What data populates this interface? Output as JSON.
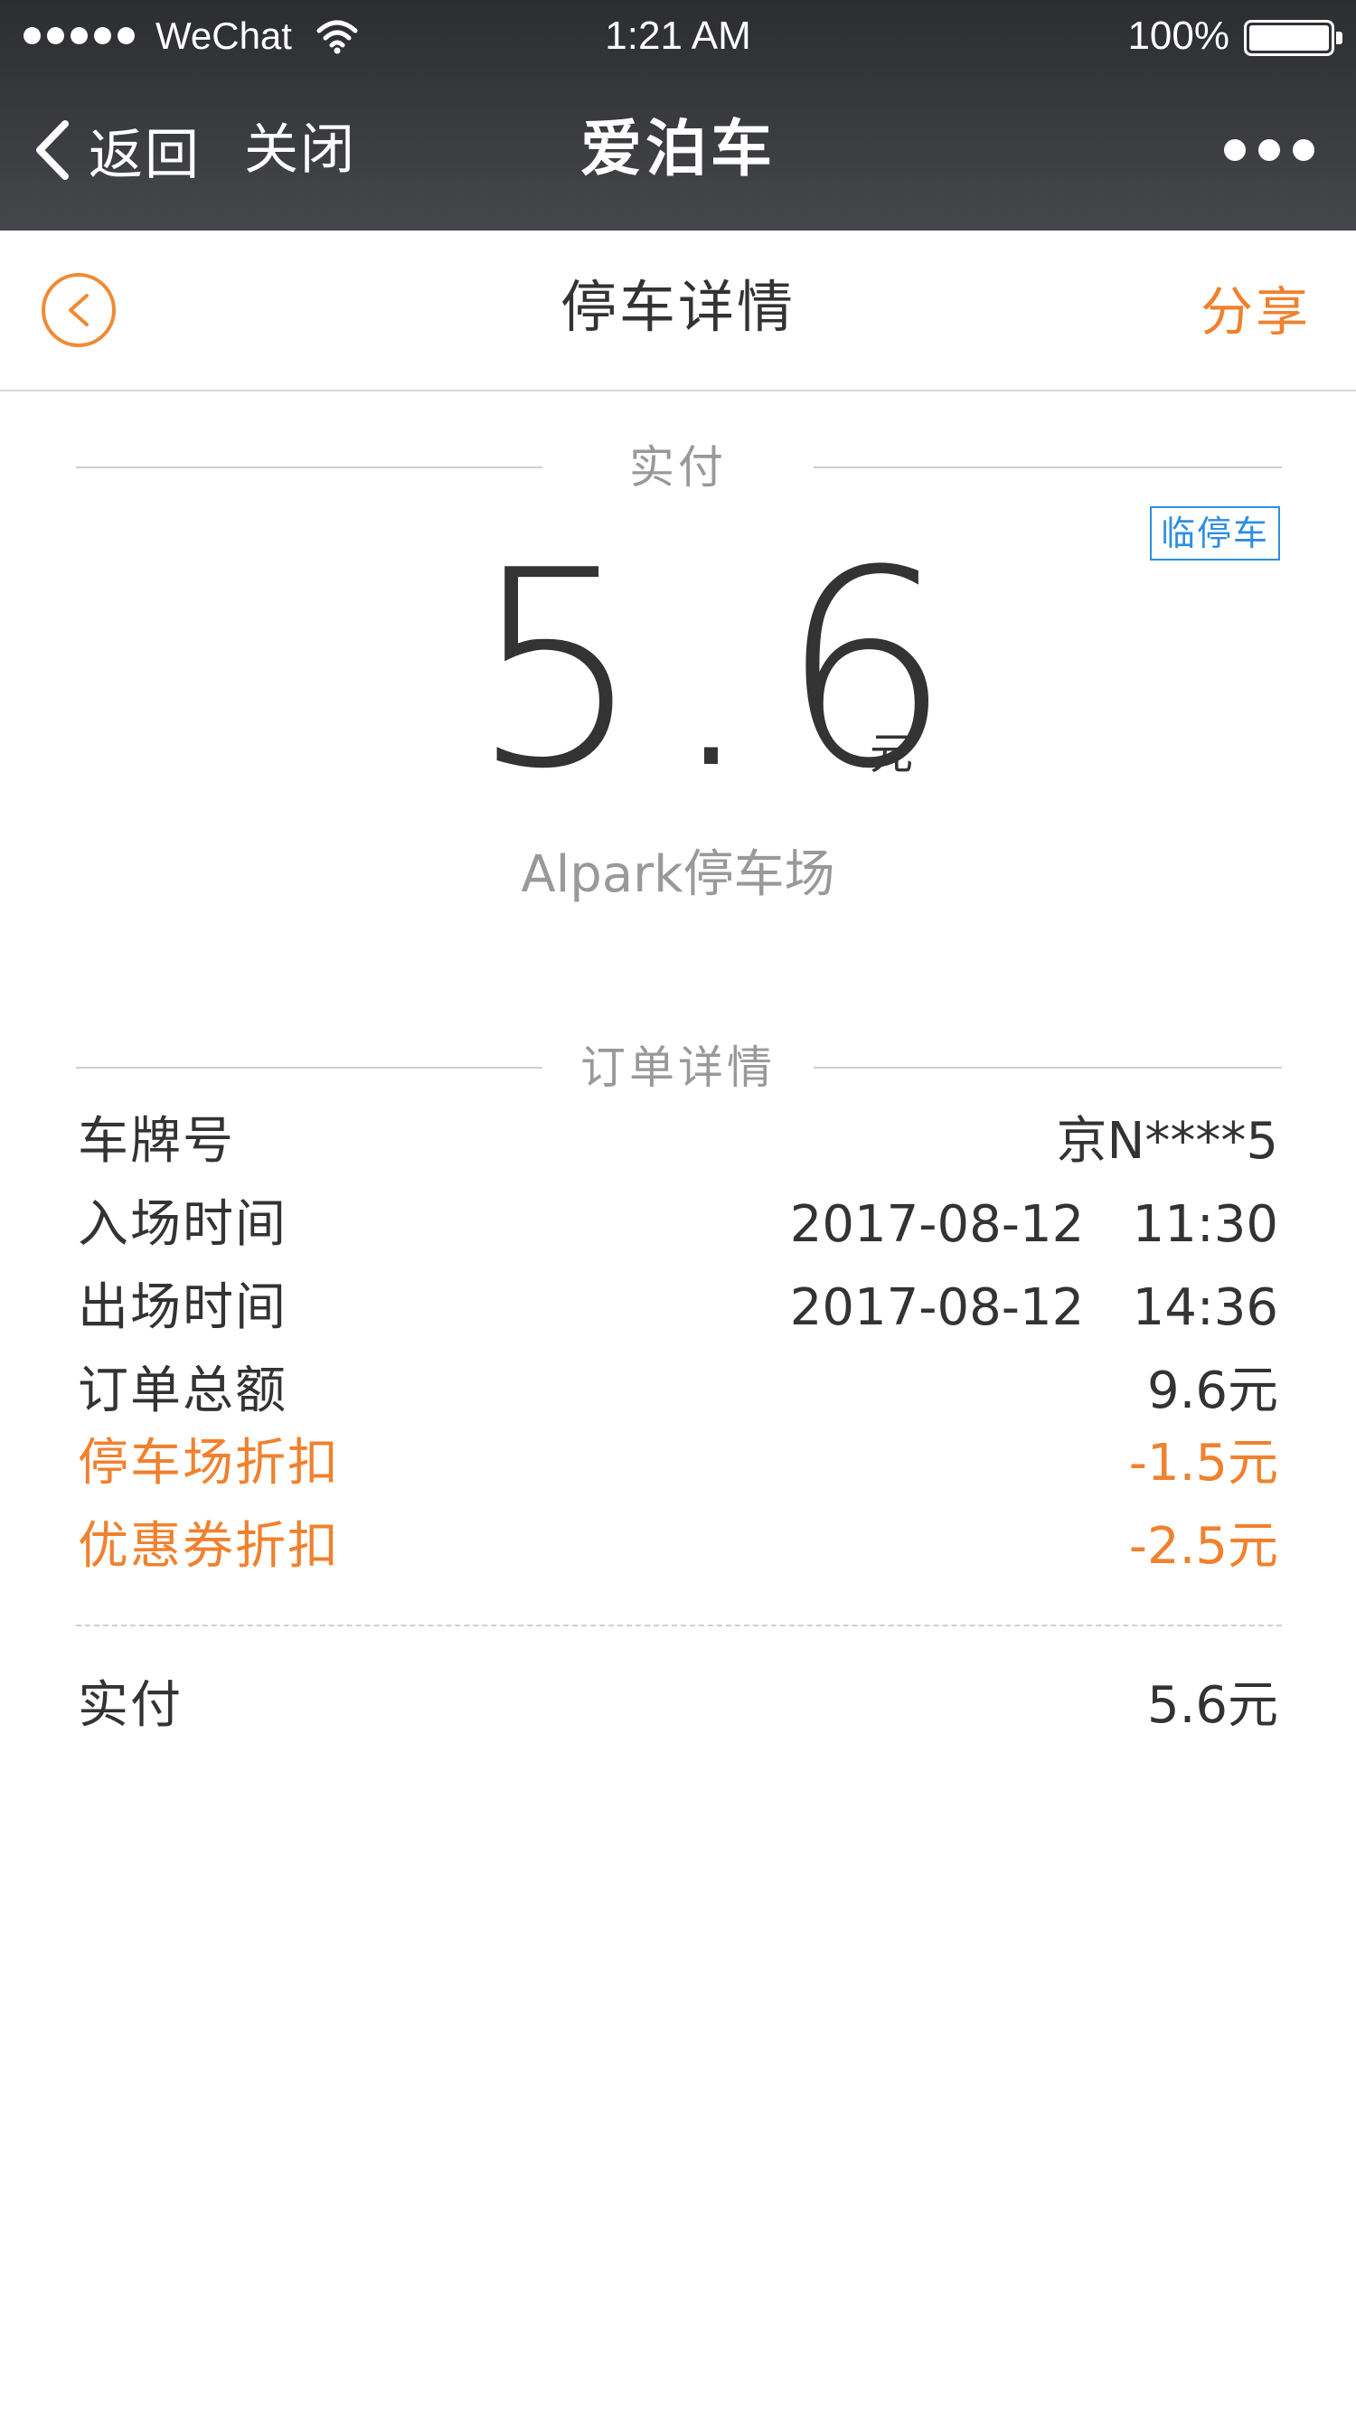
{
  "status_bar": {
    "carrier": "WeChat",
    "time": "1:21 AM",
    "battery": "100%"
  },
  "nav": {
    "back_label": "返回",
    "close_label": "关闭",
    "title": "爱泊车"
  },
  "page": {
    "title": "停车详情",
    "share_label": "分享"
  },
  "payment": {
    "section_label": "实付",
    "tag": "临停车",
    "amount": "5.6",
    "unit": "元",
    "lot_name": "Alpark停车场"
  },
  "order": {
    "section_label": "订单详情",
    "rows": [
      {
        "label": "车牌号",
        "value": "京N****5"
      },
      {
        "label": "入场时间",
        "value": "2017-08-12   11:30"
      },
      {
        "label": "出场时间",
        "value": "2017-08-12   14:36"
      },
      {
        "label": "订单总额",
        "value": "9.6元"
      },
      {
        "label": "停车场折扣",
        "value": "-1.5元"
      },
      {
        "label": "优惠券折扣",
        "value": "-2.5元"
      }
    ],
    "total": {
      "label": "实付",
      "value": "5.6元"
    }
  },
  "colors": {
    "accent": "#f0812e",
    "tag_blue": "#2f8ee0",
    "header_bg": "#2c2d31"
  },
  "icons": [
    "signal-icon",
    "wifi-icon",
    "battery-icon",
    "back-chevron-icon",
    "more-icon",
    "circle-back-icon"
  ]
}
